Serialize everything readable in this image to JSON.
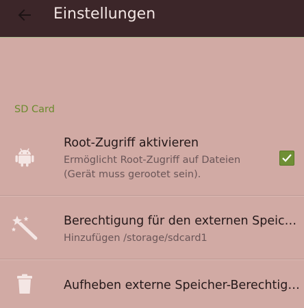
{
  "appbar": {
    "title": "Einstellungen",
    "back_icon": "arrow-back-icon"
  },
  "section": {
    "header": "SD Card"
  },
  "preferences": [
    {
      "icon": "android-icon",
      "title": "Root-Zugriff aktivieren",
      "summary_line1": "Ermöglicht Root-Zugriff auf Dateien",
      "summary_line2": "(Gerät muss gerootet sein).",
      "checked": true
    },
    {
      "icon": "magic-wand-icon",
      "title": "Berechtigung für den externen Speicher",
      "summary_line1": "Hinzufügen /storage/sdcard1"
    },
    {
      "icon": "trash-icon",
      "title": "Aufheben externe Speicher-Berechtigung"
    }
  ],
  "colors": {
    "appbar_bg": "#3c2629",
    "page_bg": "#d1aaa4",
    "accent": "#6c8a2e",
    "icon_tint": "#f4e6e4"
  }
}
